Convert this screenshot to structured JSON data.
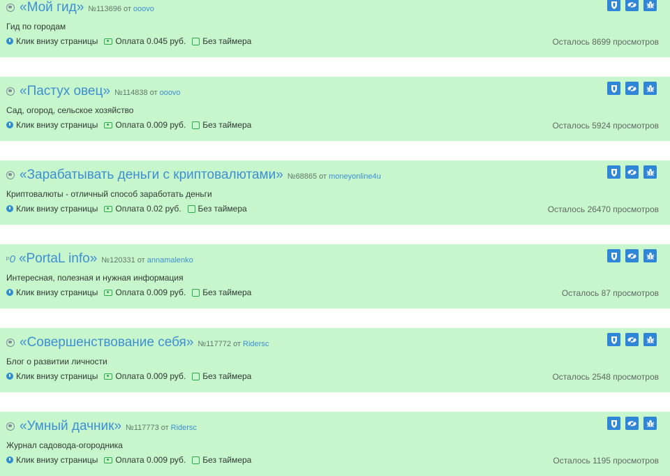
{
  "labels": {
    "number_prefix": "№",
    "from": "от",
    "click_type": "Клик внизу страницы",
    "payment_prefix": "Оплата",
    "currency": "руб.",
    "no_timer": "Без таймера",
    "remaining_prefix": "Осталось",
    "views_suffix": "просмотров"
  },
  "colors": {
    "card_background": "#c7f5cc",
    "title_link": "#3d8fd1",
    "action_button": "#2f86d6",
    "payment_icon": "#2ea84a"
  },
  "tasks": [
    {
      "icon": "globe-icon",
      "title": "«Мой гид»",
      "number": "№113696",
      "author": "ooovo",
      "description": "Гид по городам",
      "payment": "Оплата 0.045 руб.",
      "remaining": "Осталось 8699 просмотров"
    },
    {
      "icon": "globe-icon",
      "title": "«Пастух овец»",
      "number": "№114838",
      "author": "ooovo",
      "description": "Сад, огород, сельское хозяйство",
      "payment": "Оплата 0.009 руб.",
      "remaining": "Осталось 5924 просмотров"
    },
    {
      "icon": "globe-icon",
      "title": "«Зарабатывать деньги с криптовалютами»",
      "number": "№68865",
      "author": "moneyonline4u",
      "description": "Криптовалюты - отличный способ заработать деньги",
      "payment": "Оплата 0.02 руб.",
      "remaining": "Осталось 26470 просмотров"
    },
    {
      "icon": "p-logo-icon",
      "title": "«PortaL info»",
      "number": "№120331",
      "author": "annamalenko",
      "description": "Интересная, полезная и нужная информация",
      "payment": "Оплата 0.009 руб.",
      "remaining": "Осталось 87 просмотров"
    },
    {
      "icon": "globe-icon",
      "title": "«Совершенствование себя»",
      "number": "№117772",
      "author": "Ridersc",
      "description": "Блог о развитии личности",
      "payment": "Оплата 0.009 руб.",
      "remaining": "Осталось 2548 просмотров"
    },
    {
      "icon": "globe-icon",
      "title": "«Умный дачник»",
      "number": "№117773",
      "author": "Ridersc",
      "description": "Журнал садовода-огородника",
      "payment": "Оплата 0.009 руб.",
      "remaining": "Осталось 1195 просмотров"
    }
  ],
  "actions": [
    {
      "icon": "shield-icon"
    },
    {
      "icon": "eye-slash-icon"
    },
    {
      "icon": "bug-icon"
    }
  ]
}
